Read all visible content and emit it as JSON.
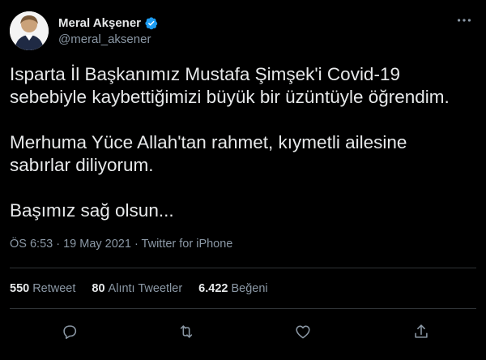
{
  "author": {
    "display_name": "Meral Akşener",
    "handle": "@meral_aksener",
    "verified": true
  },
  "tweet": {
    "paragraphs": [
      "Isparta İl Başkanımız Mustafa Şimşek'i Covid-19\nsebebiyle kaybettiğimizi büyük bir üzüntüyle öğrendim.",
      "Merhuma Yüce Allah'tan rahmet, kıymetli ailesine\nsabırlar diliyorum.",
      "Başımız sağ olsun..."
    ],
    "meta": "ÖS 6:53 · 19 May 2021 · Twitter for iPhone"
  },
  "stats": {
    "retweets_count": "550",
    "retweets_label": "Retweet",
    "quotes_count": "80",
    "quotes_label": "Alıntı Tweetler",
    "likes_count": "6.422",
    "likes_label": "Beğeni"
  },
  "icons": {
    "more": "more-options-icon",
    "reply": "reply-icon",
    "retweet": "retweet-icon",
    "like": "heart-icon",
    "share": "share-icon"
  },
  "colors": {
    "background": "#000000",
    "primary_text": "#e7e9ea",
    "secondary_text": "#8b98a5",
    "verified": "#1d9bf0",
    "divider": "#2f3336"
  }
}
